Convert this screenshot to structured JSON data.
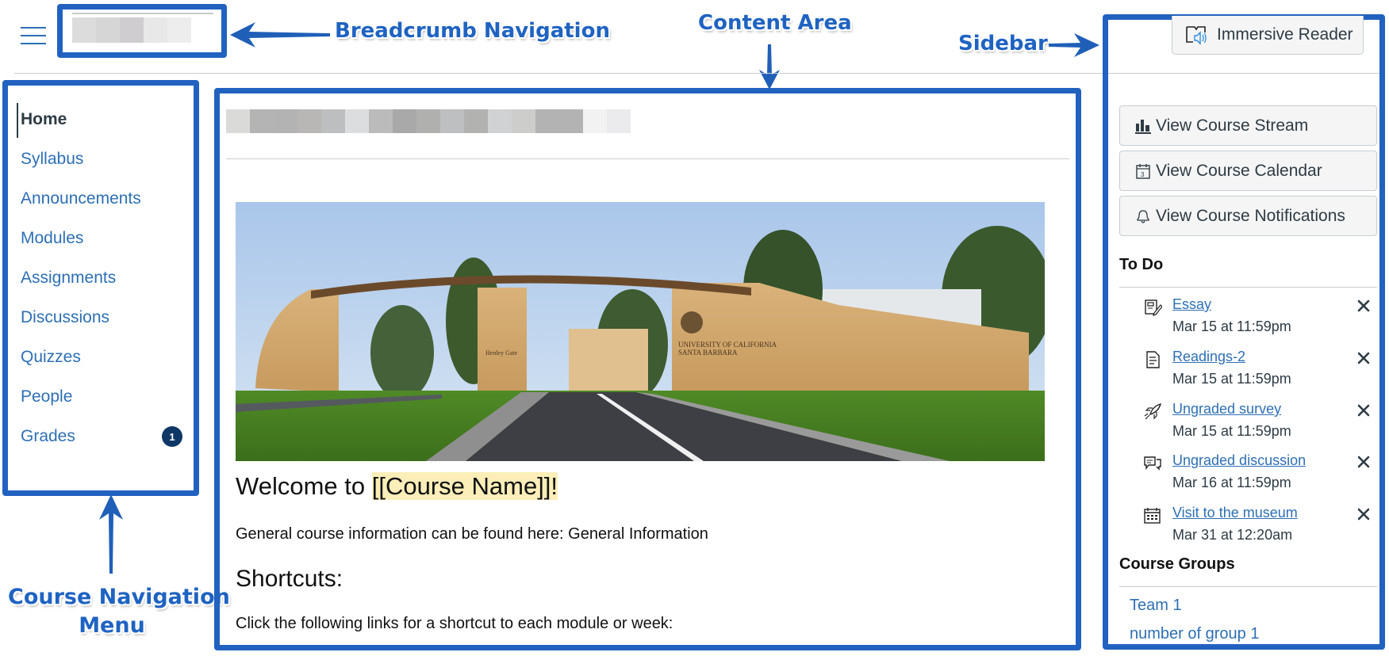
{
  "header": {
    "menu_icon": "hamburger-icon",
    "breadcrumb_blur_colors": [
      "#dcdcdc",
      "#d7d6d7",
      "#cfcdcf",
      "#e8e8e9",
      "#ededee"
    ]
  },
  "annotations": {
    "breadcrumb": "Breadcrumb Navigation",
    "content": "Content Area",
    "sidebar": "Sidebar",
    "nav_line1": "Course Navigation",
    "nav_line2": "Menu",
    "color": "#2162c0"
  },
  "nav": {
    "items": [
      {
        "label": "Home",
        "active": true
      },
      {
        "label": "Syllabus"
      },
      {
        "label": "Announcements"
      },
      {
        "label": "Modules"
      },
      {
        "label": "Assignments"
      },
      {
        "label": "Discussions"
      },
      {
        "label": "Quizzes"
      },
      {
        "label": "People"
      },
      {
        "label": "Grades",
        "badge": "1"
      }
    ]
  },
  "content": {
    "title_blur_colors": [
      "#dadad8",
      "#b4b4b4",
      "#b3b3b3",
      "#b8b7b5",
      "#bdbec0",
      "#dcdddf",
      "#bbbbbb",
      "#a9a9aa",
      "#b0b0af",
      "#bebfc0",
      "#b2b2b0",
      "#d1d2d4",
      "#cdcdcb",
      "#b3b3b3",
      "#b3b3b3",
      "#f2f2f2",
      "#ebebed"
    ],
    "hero_alt": "University of California Santa Barbara Henley Gate",
    "hero_sign_1": "UNIVERSITY OF CALIFORNIA",
    "hero_sign_2": "SANTA BARBARA",
    "hero_sign_gate": "Henley Gate",
    "welcome_prefix": "Welcome to ",
    "welcome_highlight": "[[Course Name]]!",
    "general_info": "General course information can be found here: General Information",
    "shortcuts_heading": "Shortcuts:",
    "shortcuts_text": "Click the following links for a shortcut to each module or week:"
  },
  "sidebar": {
    "immersive_reader": "Immersive Reader",
    "buttons": [
      {
        "label": "View Course Stream",
        "icon": "stream-icon"
      },
      {
        "label": "View Course Calendar",
        "icon": "calendar-icon"
      },
      {
        "label": "View Course Notifications",
        "icon": "bell-icon"
      }
    ],
    "todo_heading": "To Do",
    "todo": [
      {
        "title": "Essay",
        "date": "Mar 15 at 11:59pm",
        "icon": "assignment-icon"
      },
      {
        "title": "Readings-2",
        "date": "Mar 15 at 11:59pm",
        "icon": "document-icon"
      },
      {
        "title": "Ungraded survey",
        "date": "Mar 15 at 11:59pm",
        "icon": "quiz-rocket-icon"
      },
      {
        "title": "Ungraded discussion",
        "date": "Mar 16 at 11:59pm",
        "icon": "discussion-icon"
      },
      {
        "title": "Visit to the museum",
        "date": "Mar 31 at 12:20am",
        "icon": "calendar-event-icon"
      }
    ],
    "groups_heading": "Course Groups",
    "groups": [
      "Team 1",
      "number of group 1"
    ]
  },
  "colors": {
    "link": "#2d6fb5",
    "text": "#2d3b45",
    "badge": "#0e3765",
    "highlight": "#fbeeb8"
  }
}
